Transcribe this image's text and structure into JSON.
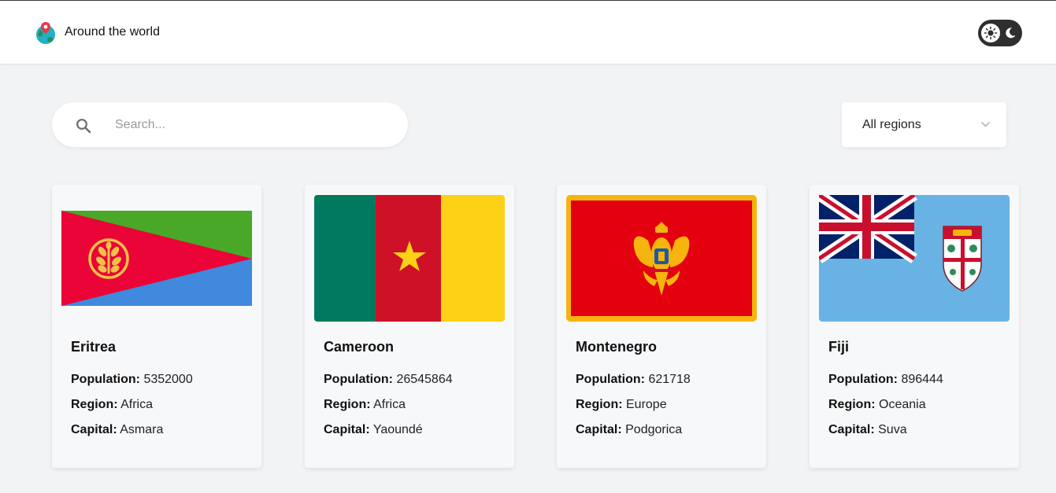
{
  "header": {
    "title": "Around the world",
    "theme_toggle": {
      "light_icon": "sun-icon",
      "dark_icon": "moon-icon"
    }
  },
  "search": {
    "placeholder": "Search...",
    "value": ""
  },
  "region_filter": {
    "selected": "All regions"
  },
  "labels": {
    "population": "Population:",
    "region": "Region:",
    "capital": "Capital:"
  },
  "countries": [
    {
      "name": "Eritrea",
      "population": "5352000",
      "region": "Africa",
      "capital": "Asmara"
    },
    {
      "name": "Cameroon",
      "population": "26545864",
      "region": "Africa",
      "capital": "Yaoundé"
    },
    {
      "name": "Montenegro",
      "population": "621718",
      "region": "Europe",
      "capital": "Podgorica"
    },
    {
      "name": "Fiji",
      "population": "896444",
      "region": "Oceania",
      "capital": "Suva"
    }
  ],
  "colors": {
    "header_bg": "#ffffff",
    "page_bg": "#f2f3f5",
    "toggle_bg": "#2f2f31"
  }
}
